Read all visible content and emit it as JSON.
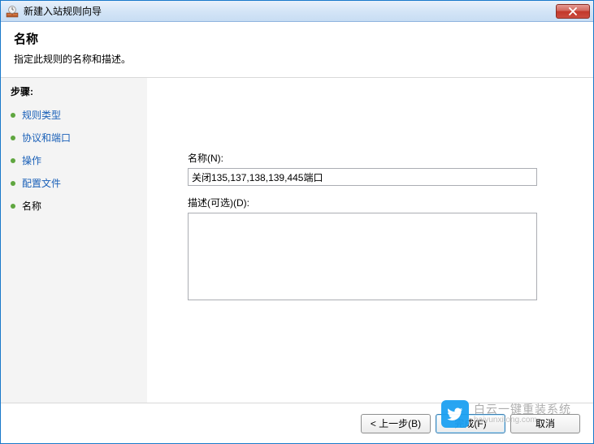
{
  "window": {
    "title": "新建入站规则向导"
  },
  "header": {
    "title": "名称",
    "subtitle": "指定此规则的名称和描述。"
  },
  "sidebar": {
    "heading": "步骤:",
    "items": [
      {
        "label": "规则类型",
        "state": "link"
      },
      {
        "label": "协议和端口",
        "state": "link"
      },
      {
        "label": "操作",
        "state": "link"
      },
      {
        "label": "配置文件",
        "state": "link"
      },
      {
        "label": "名称",
        "state": "current"
      }
    ]
  },
  "form": {
    "name_label": "名称(N):",
    "name_value": "关闭135,137,138,139,445端口",
    "desc_label": "描述(可选)(D):",
    "desc_value": ""
  },
  "footer": {
    "back": "< 上一步(B)",
    "finish": "完成(F)",
    "cancel": "取消"
  },
  "watermark": {
    "line1": "白云一键重装系统",
    "line2": "baiyunxitong.com"
  }
}
